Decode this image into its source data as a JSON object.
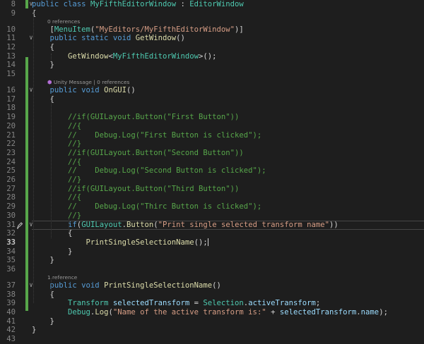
{
  "editor": {
    "active_line": 33,
    "lenses": [
      {
        "before_line": 10,
        "label": "0 references"
      },
      {
        "before_line": 16,
        "label": "Unity Message | 0 references",
        "icon": "unity-icon"
      },
      {
        "before_line": 37,
        "label": "1 reference"
      }
    ],
    "lines": [
      {
        "n": 8,
        "tokens": [
          [
            "public ",
            "k"
          ],
          [
            "class ",
            "k"
          ],
          [
            "MyFifthEditorWindow",
            "t"
          ],
          [
            " : ",
            "p"
          ],
          [
            "EditorWindow",
            "t"
          ]
        ]
      },
      {
        "n": 9,
        "tokens": [
          [
            "{",
            "p"
          ]
        ]
      },
      {
        "n": 10,
        "tokens": [
          [
            "    [",
            "p"
          ],
          [
            "MenuItem",
            "t"
          ],
          [
            "(",
            "p"
          ],
          [
            "\"MyEditors/MyFifthEditorWindow\"",
            "s"
          ],
          [
            ")]",
            "p"
          ]
        ]
      },
      {
        "n": 11,
        "tokens": [
          [
            "    ",
            "p"
          ],
          [
            "public ",
            "k"
          ],
          [
            "static ",
            "k"
          ],
          [
            "void ",
            "k"
          ],
          [
            "GetWindow",
            "m"
          ],
          [
            "()",
            "p"
          ]
        ]
      },
      {
        "n": 12,
        "tokens": [
          [
            "    {",
            "p"
          ]
        ]
      },
      {
        "n": 13,
        "tokens": [
          [
            "        ",
            "p"
          ],
          [
            "GetWindow",
            "m"
          ],
          [
            "<",
            "p"
          ],
          [
            "MyFifthEditorWindow",
            "t"
          ],
          [
            ">();",
            "p"
          ]
        ]
      },
      {
        "n": 14,
        "tokens": [
          [
            "    }",
            "p"
          ]
        ]
      },
      {
        "n": 15,
        "tokens": []
      },
      {
        "n": 16,
        "tokens": [
          [
            "    ",
            "p"
          ],
          [
            "public ",
            "k"
          ],
          [
            "void ",
            "k"
          ],
          [
            "OnGUI",
            "m"
          ],
          [
            "()",
            "p"
          ]
        ]
      },
      {
        "n": 17,
        "tokens": [
          [
            "    {",
            "p"
          ]
        ]
      },
      {
        "n": 18,
        "tokens": []
      },
      {
        "n": 19,
        "tokens": [
          [
            "        //if(GUILayout.Button(\"First Button\"))",
            "c"
          ]
        ]
      },
      {
        "n": 20,
        "tokens": [
          [
            "        //{",
            "c"
          ]
        ]
      },
      {
        "n": 21,
        "tokens": [
          [
            "        //    Debug.Log(\"First Button is clicked\");",
            "c"
          ]
        ]
      },
      {
        "n": 22,
        "tokens": [
          [
            "        //}",
            "c"
          ]
        ]
      },
      {
        "n": 23,
        "tokens": [
          [
            "        //if(GUILayout.Button(\"Second Button\"))",
            "c"
          ]
        ]
      },
      {
        "n": 24,
        "tokens": [
          [
            "        //{",
            "c"
          ]
        ]
      },
      {
        "n": 25,
        "tokens": [
          [
            "        //    Debug.Log(\"Second Button is clicked\");",
            "c"
          ]
        ]
      },
      {
        "n": 26,
        "tokens": [
          [
            "        //}",
            "c"
          ]
        ]
      },
      {
        "n": 27,
        "tokens": [
          [
            "        //if(GUILayout.Button(\"Third Button\"))",
            "c"
          ]
        ]
      },
      {
        "n": 28,
        "tokens": [
          [
            "        //{",
            "c"
          ]
        ]
      },
      {
        "n": 29,
        "tokens": [
          [
            "        //    Debug.Log(\"Thirc Button is clicked\");",
            "c"
          ]
        ]
      },
      {
        "n": 30,
        "tokens": [
          [
            "        //}",
            "c"
          ]
        ]
      },
      {
        "n": 31,
        "tokens": [
          [
            "        ",
            "p"
          ],
          [
            "if",
            "k"
          ],
          [
            "(",
            "p"
          ],
          [
            "GUILayout",
            "t"
          ],
          [
            ".",
            "p"
          ],
          [
            "Button",
            "m"
          ],
          [
            "(",
            "p"
          ],
          [
            "\"Print single selected transform name\"",
            "s"
          ],
          [
            "))",
            "p"
          ]
        ]
      },
      {
        "n": 32,
        "tokens": [
          [
            "        {",
            "p"
          ]
        ]
      },
      {
        "n": 33,
        "tokens": [
          [
            "            ",
            "p"
          ],
          [
            "PrintSingleSelectionName",
            "m"
          ],
          [
            "();",
            "p"
          ]
        ]
      },
      {
        "n": 34,
        "tokens": [
          [
            "        }",
            "p"
          ]
        ]
      },
      {
        "n": 35,
        "tokens": [
          [
            "    }",
            "p"
          ]
        ]
      },
      {
        "n": 36,
        "tokens": []
      },
      {
        "n": 37,
        "tokens": [
          [
            "    ",
            "p"
          ],
          [
            "public ",
            "k"
          ],
          [
            "void ",
            "k"
          ],
          [
            "PrintSingleSelectionName",
            "m"
          ],
          [
            "()",
            "p"
          ]
        ]
      },
      {
        "n": 38,
        "tokens": [
          [
            "    {",
            "p"
          ]
        ]
      },
      {
        "n": 39,
        "tokens": [
          [
            "        ",
            "p"
          ],
          [
            "Transform ",
            "t"
          ],
          [
            "selectedTransform",
            "v"
          ],
          [
            " = ",
            "p"
          ],
          [
            "Selection",
            "t"
          ],
          [
            ".",
            "p"
          ],
          [
            "activeTransform",
            "v"
          ],
          [
            ";",
            "p"
          ]
        ]
      },
      {
        "n": 40,
        "tokens": [
          [
            "        ",
            "p"
          ],
          [
            "Debug",
            "t"
          ],
          [
            ".",
            "p"
          ],
          [
            "Log",
            "m"
          ],
          [
            "(",
            "p"
          ],
          [
            "\"Name of the active transform is:\"",
            "s"
          ],
          [
            " + ",
            "p"
          ],
          [
            "selectedTransform",
            "v"
          ],
          [
            ".",
            "p"
          ],
          [
            "name",
            "v"
          ],
          [
            ");",
            "p"
          ]
        ]
      },
      {
        "n": 41,
        "tokens": [
          [
            "    }",
            "p"
          ]
        ]
      },
      {
        "n": 42,
        "tokens": [
          [
            "}",
            "p"
          ]
        ]
      },
      {
        "n": 43,
        "tokens": []
      }
    ]
  }
}
